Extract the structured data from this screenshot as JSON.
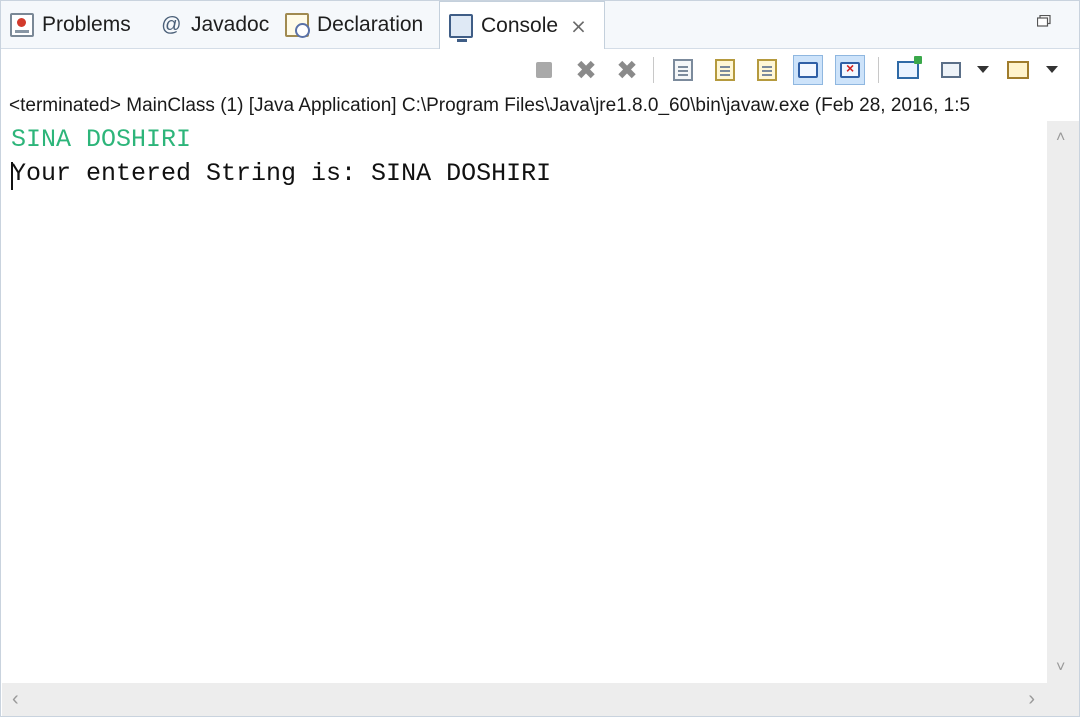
{
  "tabs": [
    {
      "label": "Problems",
      "icon": "problems-icon"
    },
    {
      "label": "Javadoc",
      "icon": "javadoc-icon"
    },
    {
      "label": "Declaration",
      "icon": "declaration-icon"
    },
    {
      "label": "Console",
      "icon": "console-icon",
      "active": true
    }
  ],
  "tab_glyphs": {
    "javadoc": "@",
    "close": "⨯"
  },
  "toolbar": {
    "buttons": [
      "terminate-icon",
      "remove-launch-icon",
      "remove-all-terminated-icon",
      "clear-console-icon",
      "scroll-lock-icon",
      "word-wrap-icon",
      "show-console-on-stdout-icon",
      "show-console-on-stderr-icon",
      "pin-console-icon",
      "display-selected-console-icon",
      "open-console-icon"
    ],
    "pressed": [
      "show-console-on-stdout-icon",
      "show-console-on-stderr-icon"
    ]
  },
  "status": "<terminated> MainClass (1) [Java Application] C:\\Program Files\\Java\\jre1.8.0_60\\bin\\javaw.exe (Feb 28, 2016, 1:5",
  "console": {
    "input_line": "SINA DOSHIRI",
    "output_line": "Your entered String is: SINA DOSHIRI",
    "input_color": "#2db57a",
    "output_color": "#111111"
  },
  "scroll_arrows": {
    "up": "˄",
    "down": "˅",
    "left": "‹",
    "right": "›"
  }
}
